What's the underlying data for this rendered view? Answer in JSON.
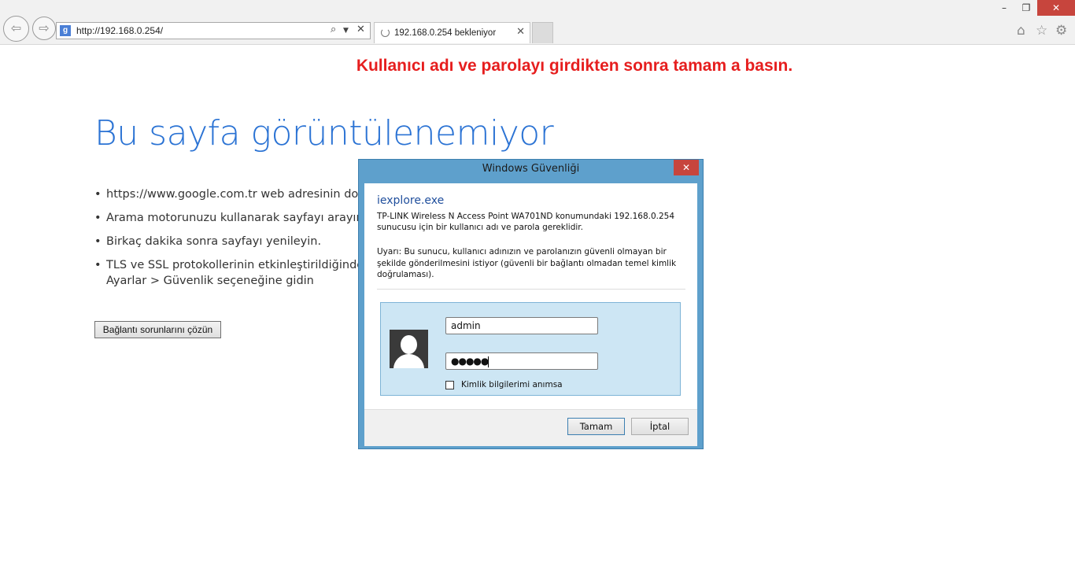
{
  "browser": {
    "address": "http://192.168.0.254/",
    "favicon_letter": "g",
    "tab_title": "192.168.0.254 bekleniyor",
    "window_controls": {
      "minimize": "–",
      "restore": "❐",
      "close": "✕"
    }
  },
  "banner": {
    "text": "Kullanıcı adı ve parolayı girdikten sonra tamam a basın.",
    "color": "#e61e1e"
  },
  "error_page": {
    "title": "Bu sayfa görüntülenemiyor",
    "suggestions": [
      "https://www.google.com.tr web adresinin doğru",
      "Arama motorunuzu kullanarak sayfayı arayın.",
      "Birkaç dakika sonra sayfayı yenileyin.",
      "TLS ve SSL protokollerinin etkinleştirildiğinden em",
      "Ayarlar > Güvenlik seçeneğine gidin"
    ],
    "fix_button": "Bağlantı sorunlarını çözün"
  },
  "dialog": {
    "title": "Windows Güvenliği",
    "close": "✕",
    "app_name": "iexplore.exe",
    "message": "TP-LINK Wireless N Access Point WA701ND konumundaki 192.168.0.254 sunucusu için bir kullanıcı adı ve parola gereklidir.",
    "warning": "Uyarı: Bu sunucu, kullanıcı adınızın ve parolanızın güvenli olmayan bir şekilde gönderilmesini istiyor (güvenli bir bağlantı olmadan temel kimlik doğrulaması).",
    "username_value": "admin",
    "password_value": "●●●●●",
    "remember_label": "Kimlik bilgilerimi anımsa",
    "ok_label": "Tamam",
    "cancel_label": "İptal"
  }
}
